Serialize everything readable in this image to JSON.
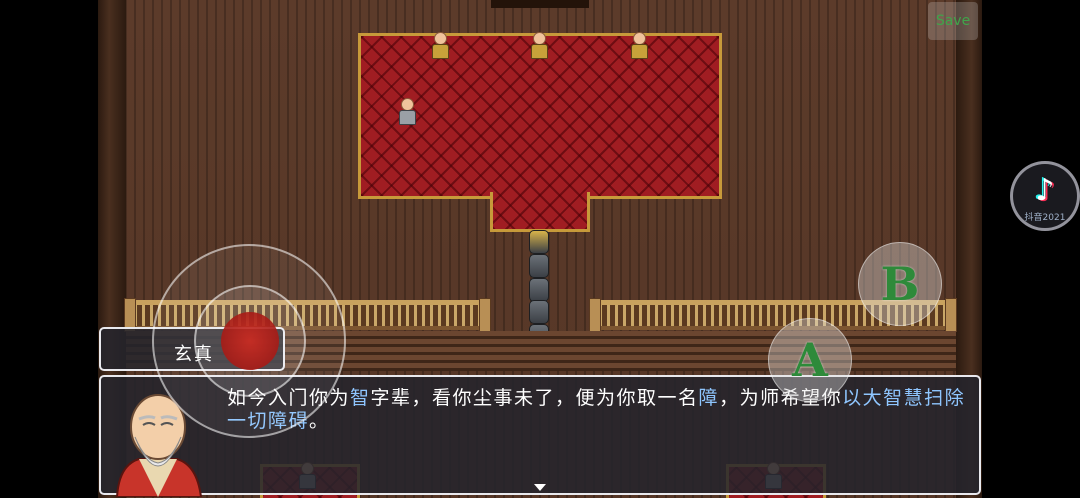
{
  "hud": {
    "save_label": "Save",
    "button_a_label": "A",
    "button_b_label": "B"
  },
  "speaker": {
    "name": "玄真"
  },
  "dialog": {
    "segments": [
      {
        "text": "如今入门你为",
        "highlight": false
      },
      {
        "text": "智",
        "highlight": true
      },
      {
        "text": "字辈，看你尘事未了，便为你取一名",
        "highlight": false
      },
      {
        "text": "障",
        "highlight": true
      },
      {
        "text": "，为师希望你",
        "highlight": false
      },
      {
        "text": "以大智慧扫除一切障碍",
        "highlight": true
      },
      {
        "text": "。",
        "highlight": false
      }
    ]
  },
  "overlay": {
    "tiktok_icon": "tiktok-icon",
    "tiktok_sub": "抖音2021"
  },
  "colors": {
    "highlight_text": "#8fc6ff",
    "carpet": "#a01d22",
    "button_letter": "#2e8a3a"
  }
}
